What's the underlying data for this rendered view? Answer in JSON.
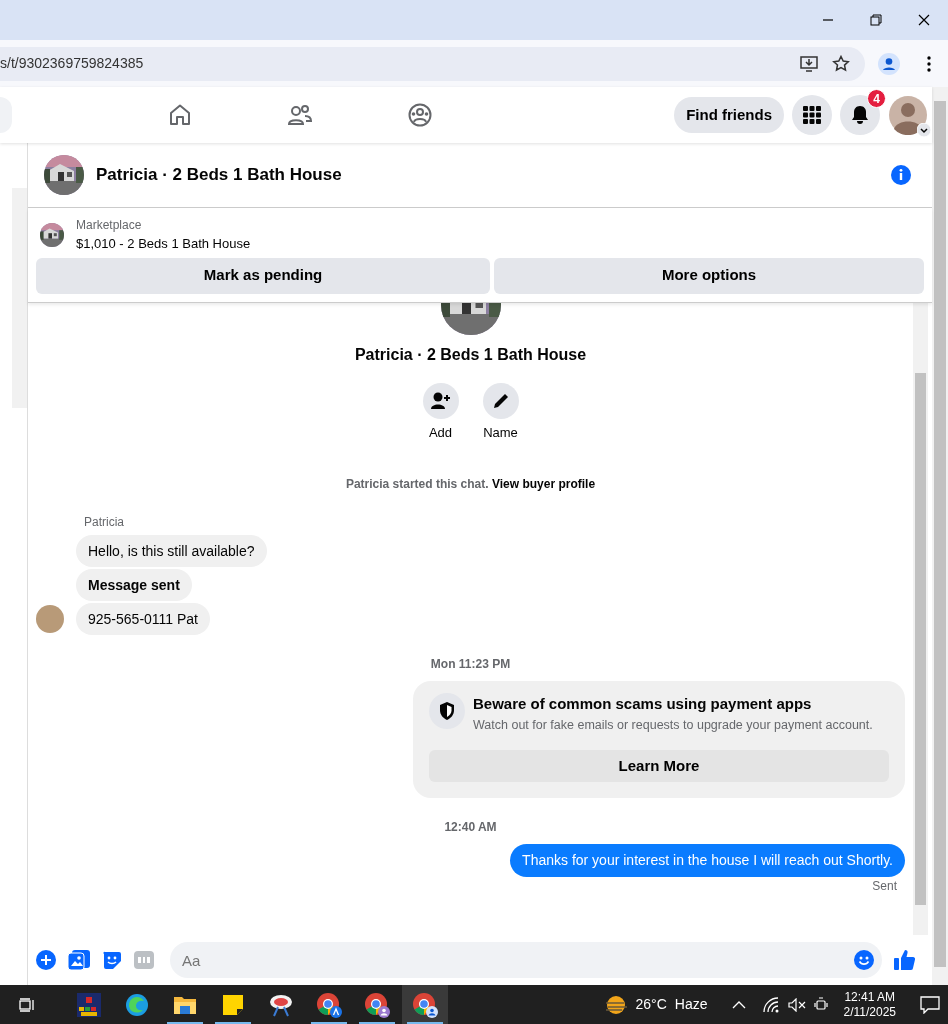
{
  "browser": {
    "url": "s/t/9302369759824385"
  },
  "top_nav": {
    "find_friends": "Find friends",
    "notification_count": "4"
  },
  "chat": {
    "title": "Patricia · 2 Beds 1 Bath House",
    "listing": {
      "source": "Marketplace",
      "title": "$1,010 - 2 Beds 1 Bath House"
    },
    "buttons": [
      "Mark as pending",
      "More options"
    ]
  },
  "thread": {
    "title": "Patricia · 2 Beds 1 Bath House",
    "actions": [
      {
        "kind": "add",
        "label": "Add"
      },
      {
        "kind": "name",
        "label": "Name"
      }
    ],
    "intro": {
      "text": "Patricia started this chat.",
      "link": "View buyer profile"
    }
  },
  "messages": [
    {
      "kind": "sender",
      "text": "Patricia"
    },
    {
      "kind": "incoming",
      "text": "Hello, is this still available?",
      "bold": false,
      "avatar": false
    },
    {
      "kind": "incoming",
      "text": "Message sent",
      "bold": true,
      "avatar": false
    },
    {
      "kind": "incoming",
      "text": "925-565-0111 Pat",
      "bold": false,
      "avatar": true
    },
    {
      "kind": "timestamp",
      "text": "Mon 11:23 PM"
    },
    {
      "kind": "notice",
      "title": "Beware of common scams using payment apps",
      "text": "Watch out for fake emails or requests to upgrade your payment account.",
      "button": "Learn More"
    },
    {
      "kind": "timestamp",
      "text": "12:40 AM"
    },
    {
      "kind": "outgoing",
      "text": "Thanks for your interest in the house I will reach out Shortly.",
      "status": "Sent"
    }
  ],
  "composer": {
    "placeholder": "Aa"
  },
  "taskbar": {
    "apps": [
      {
        "kind": "game",
        "running": false,
        "selected": false
      },
      {
        "kind": "edge",
        "running": false,
        "selected": false
      },
      {
        "kind": "folder",
        "running": true,
        "selected": false
      },
      {
        "kind": "notes",
        "running": true,
        "selected": false
      },
      {
        "kind": "snip",
        "running": false,
        "selected": false
      },
      {
        "kind": "chrome-a",
        "running": true,
        "selected": false
      },
      {
        "kind": "chrome-b",
        "running": true,
        "selected": false
      },
      {
        "kind": "chrome-c",
        "running": true,
        "selected": true
      }
    ],
    "temperature": "26°C",
    "weather": "Haze",
    "time": "12:41 AM",
    "date": "2/11/2025"
  }
}
